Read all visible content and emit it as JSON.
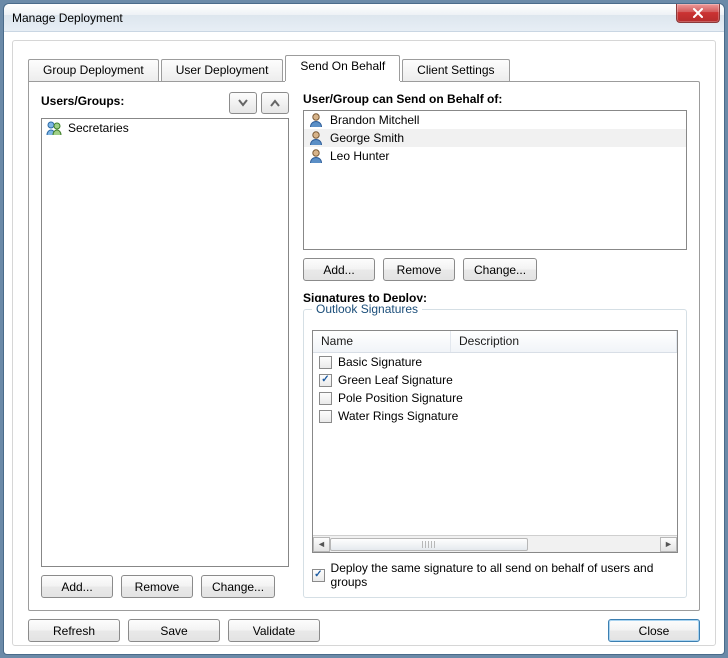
{
  "window": {
    "title": "Manage Deployment"
  },
  "tabs": {
    "group": "Group Deployment",
    "user": "User Deployment",
    "sob": "Send On Behalf",
    "client": "Client Settings"
  },
  "left": {
    "title": "Users/Groups:",
    "items": [
      "Secretaries"
    ],
    "add": "Add...",
    "remove": "Remove",
    "change": "Change..."
  },
  "right": {
    "sobTitle": "User/Group can Send on Behalf of:",
    "sobItems": [
      "Brandon Mitchell",
      "George Smith",
      "Leo Hunter"
    ],
    "sobSelectedIndex": 1,
    "add": "Add...",
    "remove": "Remove",
    "change": "Change...",
    "sigTitle": "Signatures to Deploy:",
    "groupLegend": "Outlook Signatures",
    "columns": {
      "name": "Name",
      "desc": "Description"
    },
    "rows": [
      {
        "name": "Basic Signature",
        "checked": false
      },
      {
        "name": "Green Leaf Signature",
        "checked": true
      },
      {
        "name": "Pole Position Signature",
        "checked": false
      },
      {
        "name": "Water Rings Signature",
        "checked": false
      }
    ],
    "deploySame": {
      "checked": true,
      "label": "Deploy the same signature to all send on behalf of users and groups"
    }
  },
  "bottom": {
    "refresh": "Refresh",
    "save": "Save",
    "validate": "Validate",
    "close": "Close"
  }
}
